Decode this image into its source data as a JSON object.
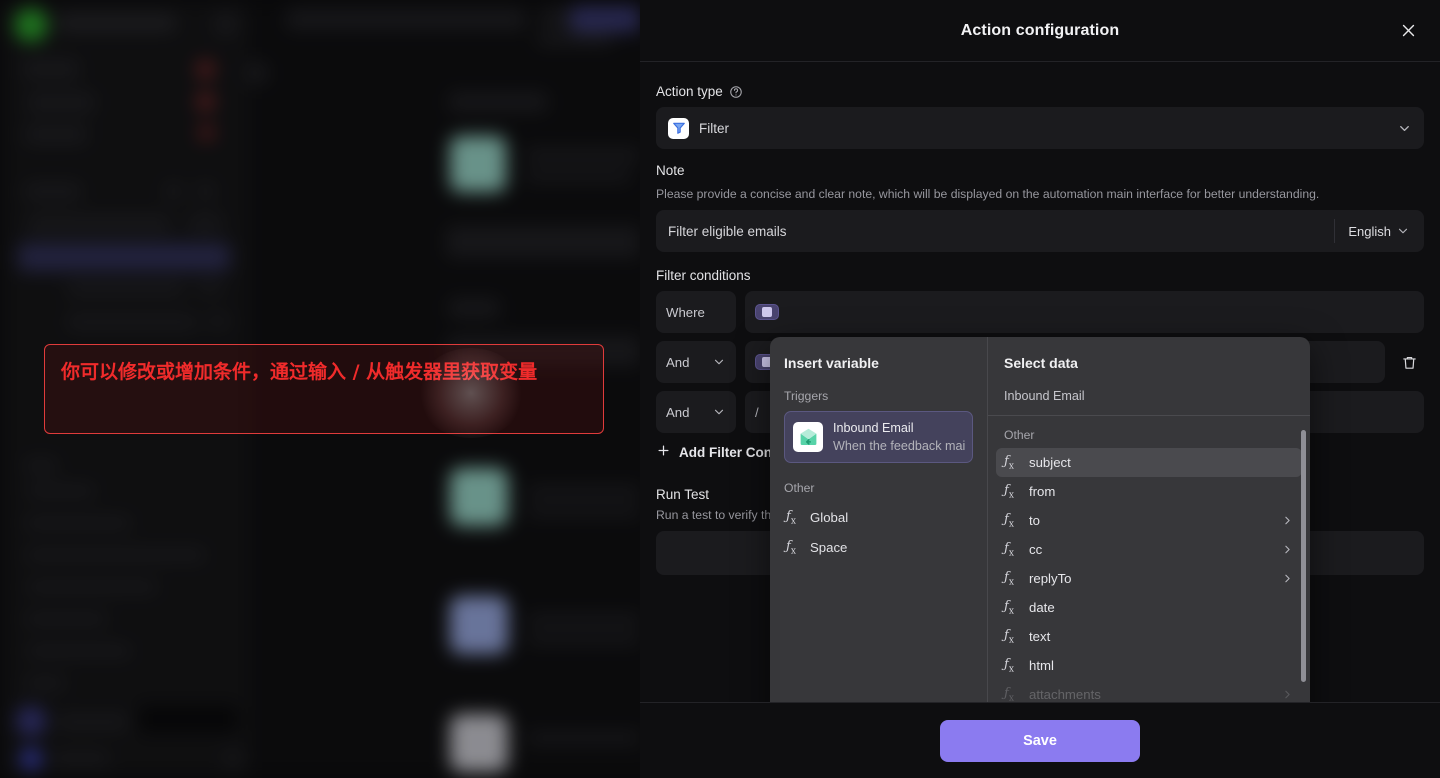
{
  "window": {
    "title": "Action configuration",
    "close_icon": "close-icon"
  },
  "background": {
    "description": "blurred automation workspace behind modal"
  },
  "form": {
    "action_type": {
      "label": "Action type",
      "help_icon": "question-circle-icon",
      "value": "Filter",
      "value_icon": "filter-app-icon",
      "chevron_icon": "chevron-down-icon"
    },
    "note": {
      "label": "Note",
      "description": "Please provide a concise and clear note, which will be displayed on the automation main interface for better understanding.",
      "value": "Filter eligible emails",
      "placeholder": "Filter eligible emails",
      "language": "English",
      "language_chevron_icon": "chevron-down-icon"
    },
    "filter_conditions": {
      "label": "Filter conditions",
      "rows": [
        {
          "conjunction": "Where",
          "has_chevron": false,
          "expression_type": "tag",
          "tag_label": "",
          "operator": ""
        },
        {
          "conjunction": "And",
          "has_chevron": true,
          "expression_type": "tag",
          "tag_label": "",
          "operator": ""
        },
        {
          "conjunction": "And",
          "has_chevron": true,
          "expression_type": "slash",
          "slash_value": "/",
          "operator": ""
        }
      ],
      "delete_icon": "trash-icon",
      "add_button": {
        "label": "Add Filter Condition",
        "icon": "plus-icon"
      }
    },
    "run_test": {
      "label": "Run Test",
      "description": "Run a test to verify the action configuration."
    }
  },
  "footer": {
    "save_label": "Save"
  },
  "variable_picker": {
    "left": {
      "title": "Insert variable",
      "groups": [
        {
          "label": "Triggers",
          "items": [
            {
              "name": "Inbound Email",
              "description": "When the feedback mai",
              "icon": "inbound-email-icon",
              "selected": true
            }
          ]
        },
        {
          "label": "Other",
          "items": [
            {
              "name": "Global",
              "icon": "fx-icon"
            },
            {
              "name": "Space",
              "icon": "fx-icon"
            }
          ]
        }
      ]
    },
    "right": {
      "title": "Select data",
      "source": "Inbound Email",
      "group_label": "Other",
      "items": [
        {
          "label": "subject",
          "icon": "fx-icon",
          "has_submenu": false,
          "highlighted": true
        },
        {
          "label": "from",
          "icon": "fx-icon",
          "has_submenu": false,
          "highlighted": false
        },
        {
          "label": "to",
          "icon": "fx-icon",
          "has_submenu": true,
          "highlighted": false
        },
        {
          "label": "cc",
          "icon": "fx-icon",
          "has_submenu": true,
          "highlighted": false
        },
        {
          "label": "replyTo",
          "icon": "fx-icon",
          "has_submenu": true,
          "highlighted": false
        },
        {
          "label": "date",
          "icon": "fx-icon",
          "has_submenu": false,
          "highlighted": false
        },
        {
          "label": "text",
          "icon": "fx-icon",
          "has_submenu": false,
          "highlighted": false
        },
        {
          "label": "html",
          "icon": "fx-icon",
          "has_submenu": false,
          "highlighted": false
        },
        {
          "label": "attachments",
          "icon": "fx-icon",
          "has_submenu": true,
          "highlighted": false
        }
      ]
    }
  },
  "annotation": {
    "text": "你可以修改或增加条件，通过输入 / 从触发器里获取变量",
    "border_color": "#e03b3b",
    "text_color": "#f02b2b"
  },
  "colors": {
    "accent": "#8b7bf0",
    "modal_bg": "#0e0e10",
    "field_bg": "#1b1b1e",
    "picker_bg": "#37373a",
    "highlight_bg": "#4a4a4e",
    "trigger_selected_bg": "#44425c"
  }
}
